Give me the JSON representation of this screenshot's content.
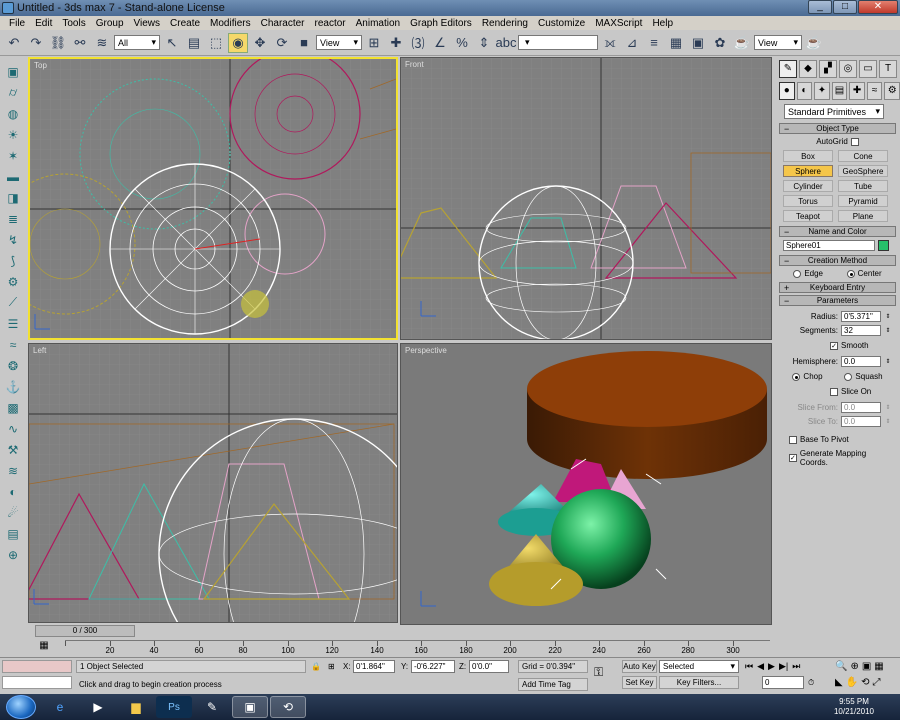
{
  "window": {
    "title": "Untitled - 3ds max 7 - Stand-alone License",
    "min": "_",
    "max": "□",
    "close": "✕"
  },
  "menu": [
    "File",
    "Edit",
    "Tools",
    "Group",
    "Views",
    "Create",
    "Modifiers",
    "Character",
    "reactor",
    "Animation",
    "Graph Editors",
    "Rendering",
    "Customize",
    "MAXScript",
    "Help"
  ],
  "toolbar": {
    "selection_filter": "All",
    "ref_coord": "View",
    "named_selection": "",
    "view_right": "View"
  },
  "viewports": {
    "top": "Top",
    "front": "Front",
    "left": "Left",
    "perspective": "Perspective"
  },
  "command_panel": {
    "primitive_type": "Standard Primitives",
    "object_type_title": "Object Type",
    "autogrid": "AutoGrid",
    "objects": [
      "Box",
      "Cone",
      "Sphere",
      "GeoSphere",
      "Cylinder",
      "Tube",
      "Torus",
      "Pyramid",
      "Teapot",
      "Plane"
    ],
    "selected_object": "Sphere",
    "name_color_title": "Name and Color",
    "object_name": "Sphere01",
    "object_color": "#27c06a",
    "creation_method_title": "Creation Method",
    "method_edge": "Edge",
    "method_center": "Center",
    "keyboard_entry_title": "Keyboard Entry",
    "parameters_title": "Parameters",
    "radius_label": "Radius:",
    "radius_value": "0'5.371\"",
    "segments_label": "Segments:",
    "segments_value": "32",
    "smooth": "Smooth",
    "hemisphere_label": "Hemisphere:",
    "hemisphere_value": "0.0",
    "chop": "Chop",
    "squash": "Squash",
    "slice_on": "Slice On",
    "slice_from_label": "Slice From:",
    "slice_from_value": "0.0",
    "slice_to_label": "Slice To:",
    "slice_to_value": "0.0",
    "base_to_pivot": "Base To Pivot",
    "gen_mapping": "Generate Mapping Coords."
  },
  "timeline": {
    "slider": "0 / 300",
    "ticks": [
      "20",
      "40",
      "60",
      "80",
      "100",
      "120",
      "140",
      "160",
      "180",
      "200",
      "220",
      "240",
      "260",
      "280",
      "300"
    ],
    "frame": "0"
  },
  "status": {
    "selected": "1 Object Selected",
    "prompt": "Click and drag to begin creation process",
    "x_label": "X:",
    "x_value": "0'1.864\"",
    "y_label": "Y:",
    "y_value": "-0'6.227\"",
    "z_label": "Z:",
    "z_value": "0'0.0\"",
    "grid": "Grid = 0'0.394\"",
    "add_time_tag": "Add Time Tag",
    "auto_key": "Auto Key",
    "set_key": "Set Key",
    "key_mode": "Selected",
    "key_filters": "Key Filters..."
  },
  "taskbar": {
    "time": "9:55 PM",
    "date": "10/21/2010"
  }
}
